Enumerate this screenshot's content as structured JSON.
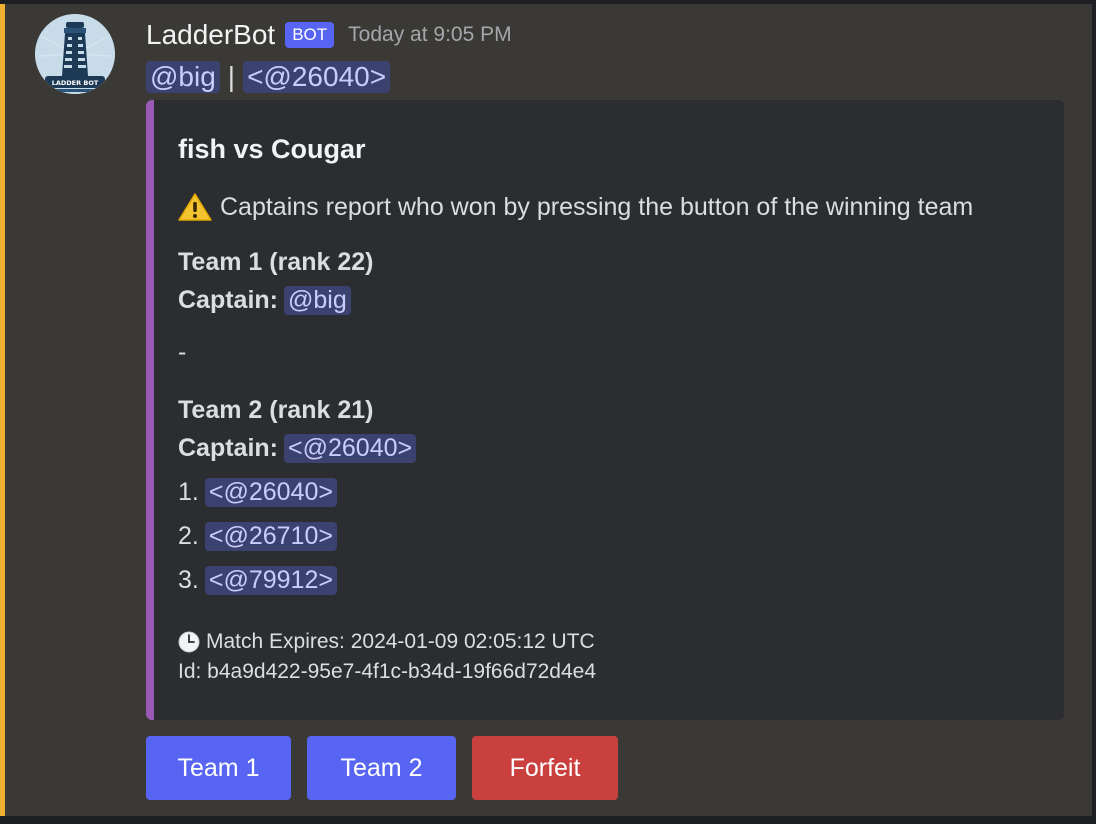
{
  "message": {
    "username": "LadderBot",
    "bot_tag": "BOT",
    "timestamp": "Today at 9:05 PM",
    "avatar_text": "LADDER BOT",
    "mentions": [
      "@big",
      "<@26040>"
    ],
    "separator": "|"
  },
  "embed": {
    "title": "fish vs Cougar",
    "notice": "Captains report who won by pressing the button of the winning team",
    "team1": {
      "heading": "Team 1 (rank 22)",
      "captain_label": "Captain:",
      "captain": "@big"
    },
    "divider": "-",
    "team2": {
      "heading": "Team 2 (rank 21)",
      "captain_label": "Captain:",
      "captain": "<@26040>",
      "members": [
        {
          "num": "1.",
          "name": "<@26040>"
        },
        {
          "num": "2.",
          "name": "<@26710>"
        },
        {
          "num": "3.",
          "name": "<@79912>"
        }
      ]
    },
    "expires": "Match Expires: 2024-01-09 02:05:12 UTC",
    "id": "Id: b4a9d422-95e7-4f1c-b34d-19f66d72d4e4"
  },
  "buttons": {
    "team1": "Team 1",
    "team2": "Team 2",
    "forfeit": "Forfeit"
  },
  "colors": {
    "accent_bar": "#f0b132",
    "embed_bar": "#9b59b6",
    "primary_button": "#5865f2",
    "danger_button": "#c9403f",
    "mention_bg": "#3c4270"
  },
  "icons": {
    "notice": "warning-icon",
    "expires": "clock-icon"
  }
}
